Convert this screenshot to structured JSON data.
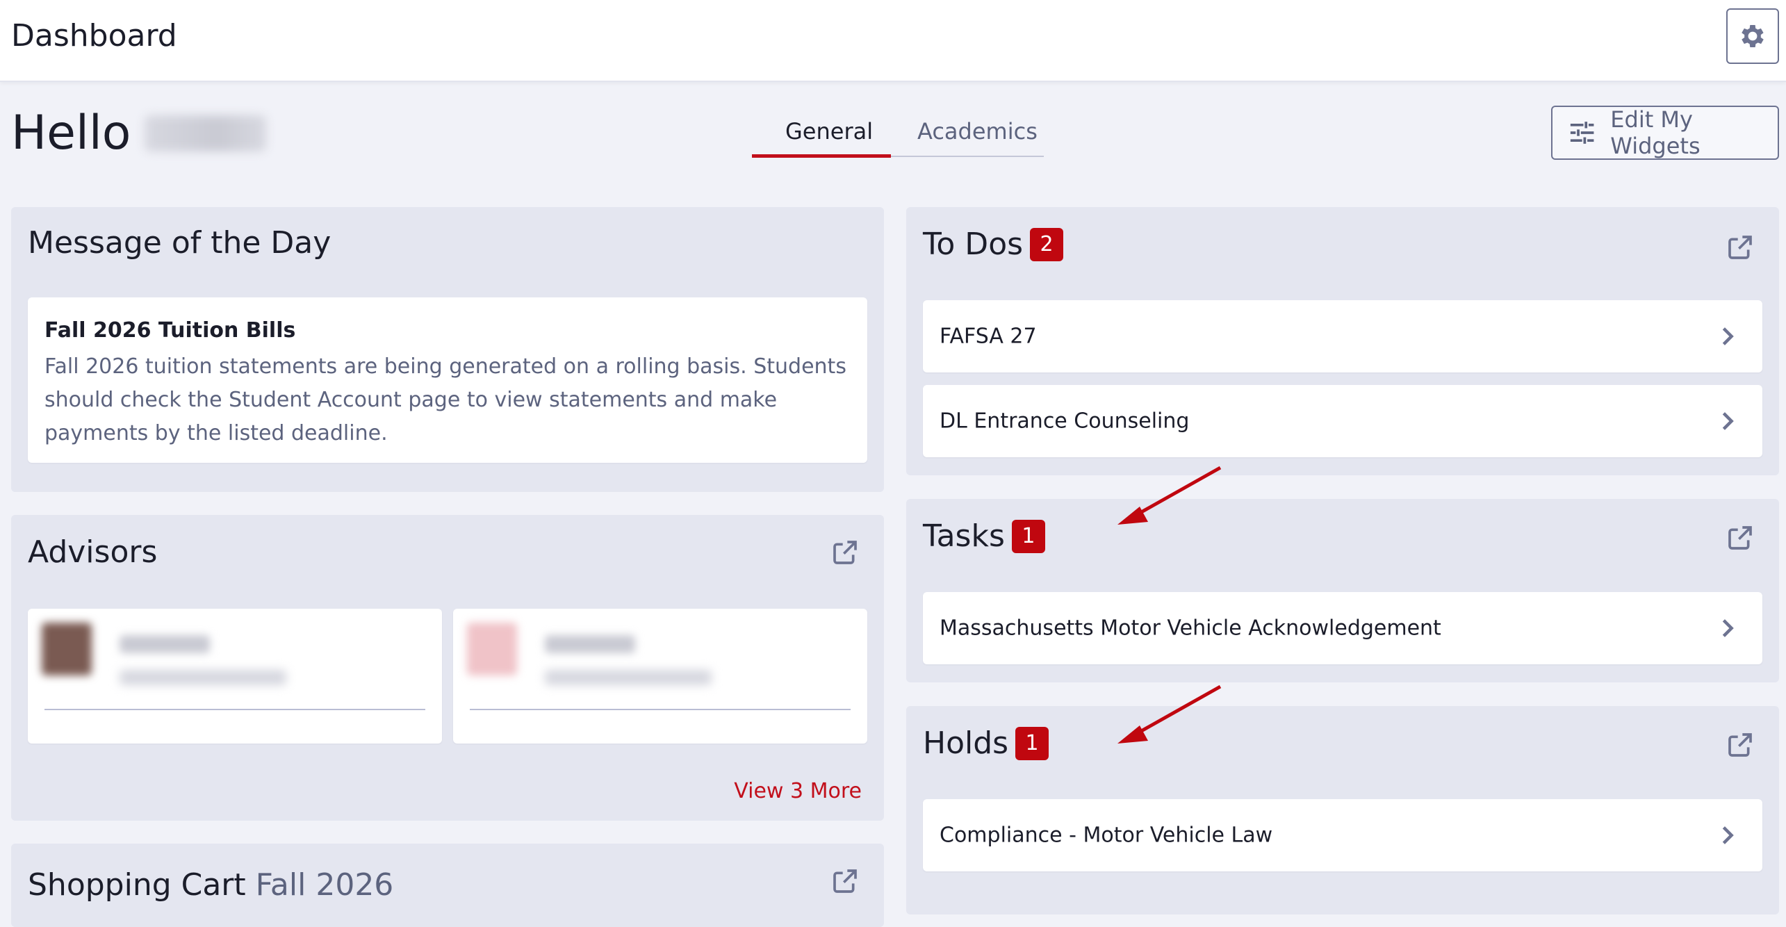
{
  "header": {
    "title": "Dashboard",
    "settings_icon": "gear-icon"
  },
  "greeting": {
    "hello": "Hello",
    "name_hidden": true
  },
  "tabs": [
    {
      "label": "General",
      "active": true
    },
    {
      "label": "Academics",
      "active": false
    }
  ],
  "edit_widgets": {
    "label": "Edit My Widgets",
    "icon": "sliders-icon"
  },
  "message_of_day": {
    "title": "Message of the Day",
    "item_title": "Fall 2026 Tuition Bills",
    "item_body": "Fall 2026 tuition statements are being generated on a rolling basis. Students should check the Student Account page to view statements and make payments by the listed deadline."
  },
  "advisors": {
    "title": "Advisors",
    "view_more": "View 3 More",
    "icon": "external-link-icon"
  },
  "shopping_cart": {
    "title": "Shopping Cart",
    "term": "Fall 2026"
  },
  "todos": {
    "title": "To Dos",
    "count": "2",
    "items": [
      "FAFSA 27",
      "DL Entrance Counseling"
    ]
  },
  "tasks": {
    "title": "Tasks",
    "count": "1",
    "items": [
      "Massachusetts Motor Vehicle Acknowledgement"
    ]
  },
  "holds": {
    "title": "Holds",
    "count": "1",
    "items": [
      "Compliance - Motor Vehicle Law"
    ]
  },
  "colors": {
    "accent_red": "#c20f1b",
    "badge_red": "#c0070f",
    "panel_bg": "#e4e6f0",
    "page_bg": "#f1f2f8",
    "muted_text": "#5c637e"
  }
}
